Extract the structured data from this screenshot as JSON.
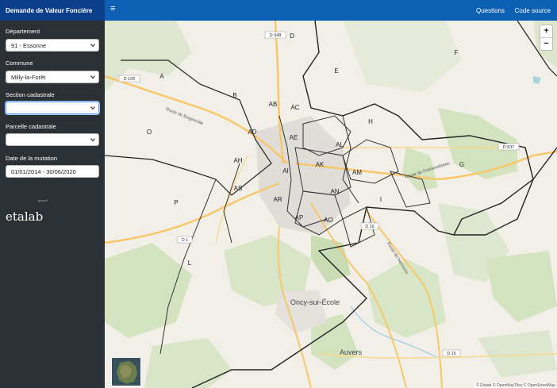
{
  "app": {
    "title": "Demande de Valeur Foncière"
  },
  "nav": {
    "menu_icon": "hamburger-icon",
    "questions": "Questions",
    "source": "Code source"
  },
  "form": {
    "departement": {
      "label": "Département",
      "value": "91 - Essonne"
    },
    "commune": {
      "label": "Commune",
      "value": "Milly-la-Forêt"
    },
    "section": {
      "label": "Section cadastrale",
      "value": ""
    },
    "parcelle": {
      "label": "Parcelle cadastrale",
      "value": ""
    },
    "date": {
      "label": "Date de la mutation",
      "value": "01/01/2014 - 30/06/2020"
    }
  },
  "logo": {
    "text": "etalab",
    "sup": "gouv.fr"
  },
  "map": {
    "zoom_in": "+",
    "zoom_out": "−",
    "attribution": "© Etalab © OpenMapTiles © OpenStreetMap",
    "sections": [
      "D",
      "E",
      "F",
      "A",
      "B",
      "AB",
      "AC",
      "H",
      "O",
      "AD",
      "AE",
      "AL",
      "G",
      "AH",
      "AI",
      "AK",
      "AM",
      "AS",
      "AR",
      "AN",
      "I",
      "P",
      "AP",
      "AO",
      "L"
    ],
    "places": [
      "Oncy-sur-École",
      "Auvers"
    ],
    "roads": [
      "D 948",
      "D 105",
      "D 837",
      "D 16",
      "D 1",
      "D 16"
    ],
    "street_labels": [
      "Route de Boigneville",
      "Route de Fontainebleau",
      "Route de Nemours"
    ]
  },
  "colors": {
    "sidebar": "#2b3035",
    "topbar": "#0d5fb3",
    "header": "#0b3f8a",
    "road": "#f6c86a",
    "forest": "#d3e3c0",
    "water": "#aad3df"
  }
}
